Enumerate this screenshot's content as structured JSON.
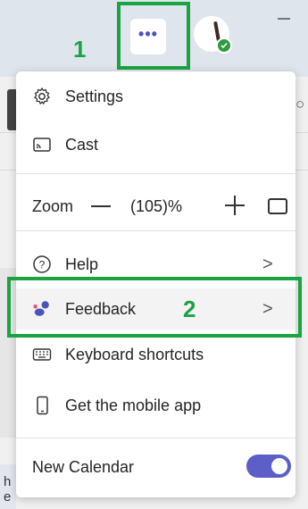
{
  "annotations": {
    "step1": "1",
    "step2": "2"
  },
  "titlebar": {
    "more_button_glyph": "•••",
    "more_icon": "more-horizontal-icon",
    "avatar_icon": "avatar-icon"
  },
  "background": {
    "partial_text_line1": "h",
    "partial_text_line2": "e"
  },
  "menu": {
    "settings": {
      "label": "Settings",
      "icon": "gear-icon"
    },
    "cast": {
      "label": "Cast",
      "icon": "cast-icon"
    },
    "zoom": {
      "label": "Zoom",
      "value": "(105)%",
      "minus_icon": "zoom-out-icon",
      "plus_icon": "zoom-in-icon",
      "fullscreen_icon": "fullscreen-icon"
    },
    "help": {
      "label": "Help",
      "icon": "help-circle-icon",
      "chevron": ">"
    },
    "feedback": {
      "label": "Feedback",
      "icon": "feedback-icon",
      "chevron": ">"
    },
    "keyboard_shortcuts": {
      "label": "Keyboard shortcuts",
      "icon": "keyboard-icon"
    },
    "mobile_app": {
      "label": "Get the mobile app",
      "icon": "mobile-phone-icon"
    },
    "new_calendar": {
      "label": "New Calendar",
      "toggle_on": true
    }
  },
  "colors": {
    "accent": "#5b5fc7",
    "annotation_green": "#1aa343",
    "feedback_purple": "#4b53bc",
    "presence_green": "#2e9b40"
  }
}
